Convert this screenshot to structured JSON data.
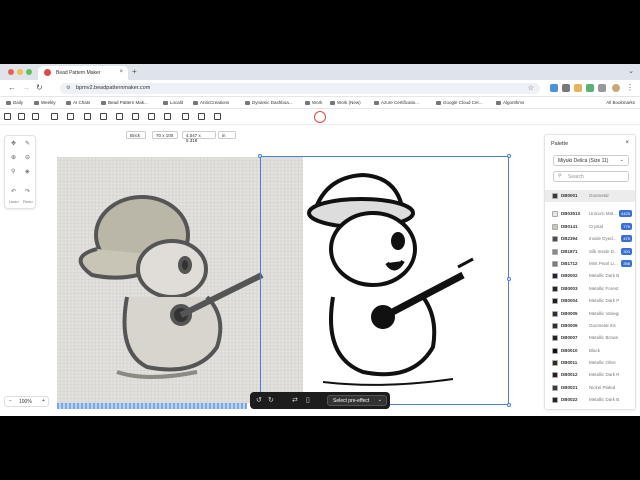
{
  "tab": {
    "title": "Bead Pattern Maker",
    "close": "×",
    "new_tab": "+"
  },
  "address": {
    "url": "bpmv2.beadpatternmaker.com"
  },
  "bookmarks": [
    "Daily",
    "Weekly",
    "AI Chats",
    "Bead Pattern Mak...",
    "Localit",
    "AnticCreations",
    "Dynamic Dashboa...",
    "Work",
    "Work (New)",
    "Azure Certificatio...",
    "Google Cloud Cer...",
    "Algorithms"
  ],
  "bookmarks_all": "All Bookmarks",
  "canvas_settings": {
    "stitch": "Brick",
    "size": "70 x 100",
    "dimensions": "4.047 x 5.318",
    "unit": "in"
  },
  "left_tools": {
    "undo": "Undo",
    "redo": "Redo"
  },
  "zoom": {
    "level": "100%",
    "minus": "−",
    "plus": "+"
  },
  "floating_bar": {
    "select_label": "Select pre-effect"
  },
  "palette": {
    "title": "Palette",
    "close": "×",
    "selected_brand": "Miyuki Delica (Size 11)",
    "search_placeholder": "Search",
    "items": [
      {
        "code": "DB0001",
        "name": "Gunmetal",
        "color": "#3a3a3c",
        "count": "",
        "active": true
      },
      {
        "code": "DB0351X",
        "name": "Unicorn Mat...",
        "color": "#e6e6e3",
        "count": "4425",
        "active": false
      },
      {
        "code": "DB0141",
        "name": "Crystal",
        "color": "#c7c8b8",
        "count": "776",
        "active": false
      },
      {
        "code": "DB2394",
        "name": "Inside Dyed...",
        "color": "#4c4c4c",
        "count": "475",
        "active": false
      },
      {
        "code": "DB1871",
        "name": "Silk Inside D...",
        "color": "#8a8a88",
        "count": "303",
        "active": false
      },
      {
        "code": "DB1712",
        "name": "Mint Pearl Li...",
        "color": "#7d7d7a",
        "count": "398",
        "active": false
      },
      {
        "code": "DB0002",
        "name": "Metallic Dark Blue Iris",
        "color": "#1f2530",
        "count": "",
        "active": false
      },
      {
        "code": "DB0003",
        "name": "Metallic Forest Green Iris",
        "color": "#1f2a22",
        "count": "",
        "active": false
      },
      {
        "code": "DB0004",
        "name": "Metallic Dark Plum Iris",
        "color": "#231a26",
        "count": "",
        "active": false
      },
      {
        "code": "DB0005",
        "name": "Metallic Variegated Blue...",
        "color": "#2a2d38",
        "count": "",
        "active": false
      },
      {
        "code": "DB0006",
        "name": "Gunmetal Iris",
        "color": "#303033",
        "count": "",
        "active": false
      },
      {
        "code": "DB0007",
        "name": "Metallic Brown Iris",
        "color": "#2c241e",
        "count": "",
        "active": false
      },
      {
        "code": "DB0010",
        "name": "Black",
        "color": "#111111",
        "count": "",
        "active": false
      },
      {
        "code": "DB0011",
        "name": "Metallic Olive",
        "color": "#2f2e22",
        "count": "",
        "active": false
      },
      {
        "code": "DB0012",
        "name": "Metallic Dark Raspberry...",
        "color": "#2e1a20",
        "count": "",
        "active": false
      },
      {
        "code": "DB0021",
        "name": "Nickel Plated",
        "color": "#3c3c3e",
        "count": "",
        "active": false
      },
      {
        "code": "DB0022",
        "name": "Metallic Dark Bronze",
        "color": "#2a241d",
        "count": "",
        "active": false
      }
    ]
  }
}
